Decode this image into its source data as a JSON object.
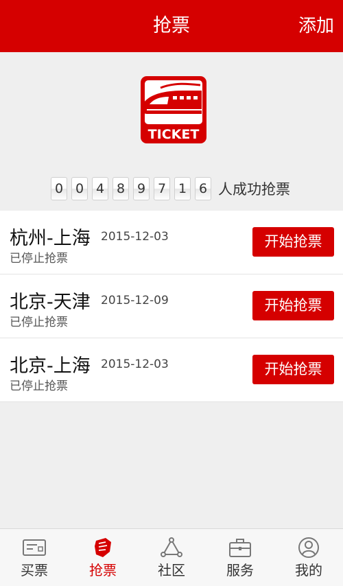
{
  "header": {
    "title": "抢票",
    "add_label": "添加"
  },
  "logo": {
    "text": "TICKET"
  },
  "counter": {
    "digits": [
      "0",
      "0",
      "4",
      "8",
      "9",
      "7",
      "1",
      "6"
    ],
    "label": "人成功抢票"
  },
  "tickets": [
    {
      "route": "杭州-上海",
      "date": "2015-12-03",
      "status": "已停止抢票",
      "button": "开始抢票"
    },
    {
      "route": "北京-天津",
      "date": "2015-12-09",
      "status": "已停止抢票",
      "button": "开始抢票"
    },
    {
      "route": "北京-上海",
      "date": "2015-12-03",
      "status": "已停止抢票",
      "button": "开始抢票"
    }
  ],
  "tabs": [
    {
      "label": "买票",
      "icon": "ticket-card-icon",
      "active": false
    },
    {
      "label": "抢票",
      "icon": "grab-hand-icon",
      "active": true
    },
    {
      "label": "社区",
      "icon": "community-triangle-icon",
      "active": false
    },
    {
      "label": "服务",
      "icon": "briefcase-icon",
      "active": false
    },
    {
      "label": "我的",
      "icon": "user-profile-icon",
      "active": false
    }
  ],
  "colors": {
    "brand_red": "#d50000",
    "background": "#efefef"
  }
}
